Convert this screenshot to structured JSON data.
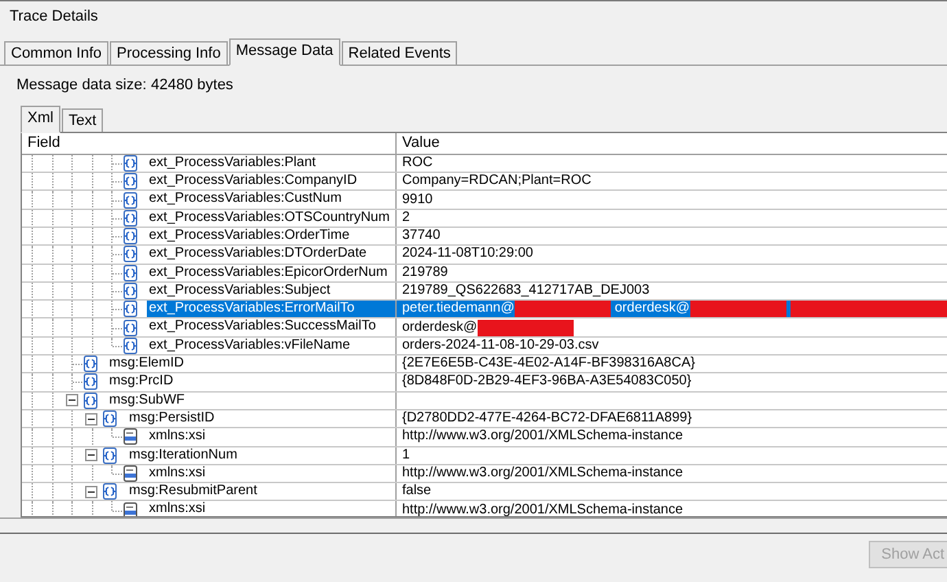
{
  "window": {
    "title": "Trace Details"
  },
  "tabs": [
    {
      "label": "Common Info",
      "selected": false
    },
    {
      "label": "Processing Info",
      "selected": false
    },
    {
      "label": "Message Data",
      "selected": true
    },
    {
      "label": "Related Events",
      "selected": false
    }
  ],
  "message_size": {
    "label": "Message data size:",
    "value": "42480 bytes"
  },
  "view_tabs": [
    {
      "label": "Xml",
      "selected": true
    },
    {
      "label": "Text",
      "selected": false
    }
  ],
  "table": {
    "columns": [
      "Field",
      "Value"
    ],
    "rows": [
      {
        "children": [
          {
            "children": [
              {
                "field": "ext_ProcessVariables:Plant",
                "kind": "element",
                "selected": false,
                "value": "ROC"
              },
              {
                "field": "ext_ProcessVariables:CompanyID",
                "kind": "element",
                "selected": false,
                "value": "Company=RDCAN;Plant=ROC"
              },
              {
                "field": "ext_ProcessVariables:CustNum",
                "kind": "element",
                "selected": false,
                "value": "9910"
              },
              {
                "field": "ext_ProcessVariables:OTSCountryNum",
                "kind": "element",
                "selected": false,
                "value": "2"
              },
              {
                "field": "ext_ProcessVariables:OrderTime",
                "kind": "element",
                "selected": false,
                "value": "37740"
              },
              {
                "field": "ext_ProcessVariables:DTOrderDate",
                "kind": "element",
                "selected": false,
                "value": "2024-11-08T10:29:00"
              },
              {
                "field": "ext_ProcessVariables:EpicorOrderNum",
                "kind": "element",
                "selected": false,
                "value": "219789"
              },
              {
                "field": "ext_ProcessVariables:Subject",
                "kind": "element",
                "selected": false,
                "value": "219789_QS622683_412717AB_DEJ003"
              },
              {
                "field": "ext_ProcessVariables:ErrorMailTo",
                "kind": "element",
                "selected": true,
                "value_parts": [
                  {
                    "kind": "text",
                    "text": "peter.tiedemann@"
                  },
                  {
                    "kind": "redacted"
                  },
                  {
                    "kind": "text",
                    "text": "orderdesk@"
                  },
                  {
                    "kind": "redacted"
                  },
                  {
                    "kind": "redacted-wide"
                  }
                ]
              },
              {
                "field": "ext_ProcessVariables:SuccessMailTo",
                "kind": "element",
                "selected": false,
                "value_parts": [
                  {
                    "kind": "text",
                    "text": "orderdesk@"
                  },
                  {
                    "kind": "redacted"
                  }
                ]
              },
              {
                "field": "ext_ProcessVariables:vFileName",
                "kind": "element",
                "selected": false,
                "value": "orders-2024-11-08-10-29-03.csv"
              }
            ]
          }
        ]
      },
      {
        "field": "msg:ElemID",
        "kind": "element",
        "selected": false,
        "value": "{2E7E6E5B-C43E-4E02-A14F-BF398316A8CA}"
      },
      {
        "field": "msg:PrcID",
        "kind": "element",
        "selected": false,
        "value": "{8D848F0D-2B29-4EF3-96BA-A3E54083C050}"
      },
      {
        "field": "msg:SubWF",
        "kind": "element",
        "selected": false,
        "expanded": true,
        "children": [
          {
            "field": "msg:PersistID",
            "kind": "element",
            "selected": false,
            "expanded": true,
            "value": "{D2780DD2-477E-4264-BC72-DFAE6811A899}",
            "children": [
              {
                "field": "xmlns:xsi",
                "kind": "attribute",
                "selected": false,
                "value": "http://www.w3.org/2001/XMLSchema-instance"
              }
            ]
          },
          {
            "field": "msg:IterationNum",
            "kind": "element",
            "selected": false,
            "expanded": true,
            "value": "1",
            "children": [
              {
                "field": "xmlns:xsi",
                "kind": "attribute",
                "selected": false,
                "value": "http://www.w3.org/2001/XMLSchema-instance"
              }
            ]
          },
          {
            "field": "msg:ResubmitParent",
            "kind": "element",
            "selected": false,
            "expanded": true,
            "value": "false",
            "children": [
              {
                "field": "xmlns:xsi",
                "kind": "attribute",
                "selected": false,
                "value": "http://www.w3.org/2001/XMLSchema-instance"
              }
            ]
          }
        ]
      }
    ]
  },
  "buttons": [
    {
      "label": "Show Act",
      "disabled": true
    }
  ]
}
